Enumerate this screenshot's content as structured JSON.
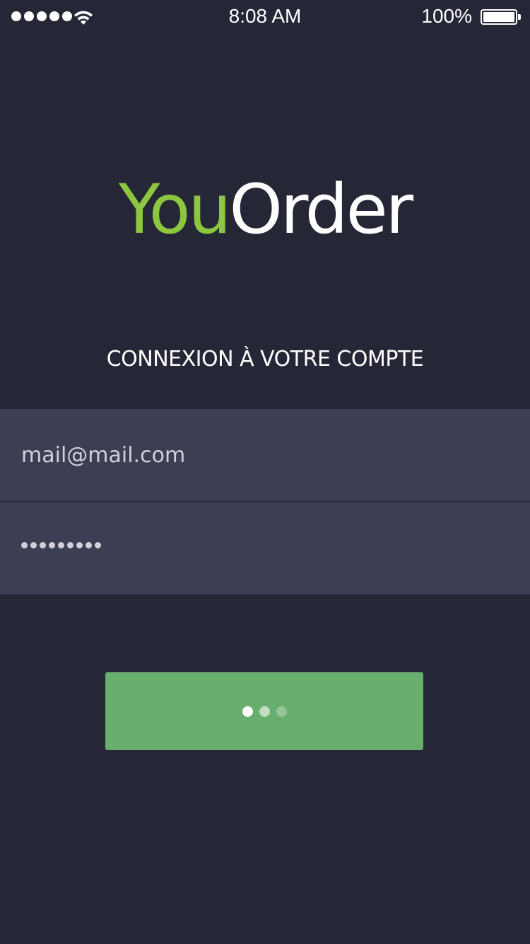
{
  "status_bar": {
    "time": "8:08 AM",
    "battery_percent": "100%",
    "signal_bars": 5,
    "battery_level": 1.0,
    "icons": [
      "signal-icon",
      "wifi-icon",
      "battery-icon"
    ]
  },
  "logo": {
    "part1": "You",
    "part2": "Order",
    "part1_color": "#8dc63f",
    "part2_color": "#ffffff"
  },
  "login": {
    "title": "CONNEXION À VOTRE COMPTE",
    "email_value": "mail@mail.com",
    "password_masked": "••••••••••",
    "submit_state": "loading"
  },
  "colors": {
    "background": "#252737",
    "field_background": "#3c3e54",
    "button": "#68ae6c",
    "accent": "#8dc63f"
  }
}
